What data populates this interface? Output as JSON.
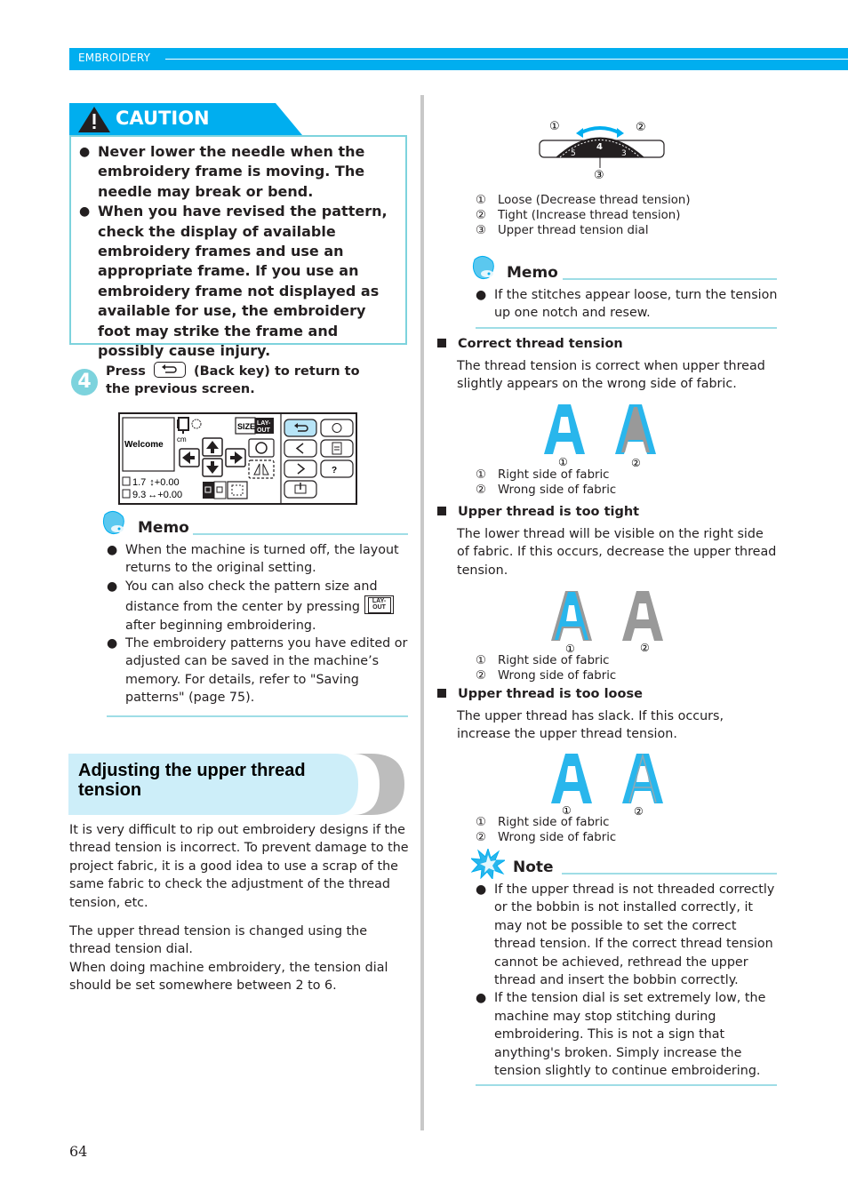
{
  "header": {
    "section_label": "EMBROIDERY"
  },
  "caution": {
    "title": "CAUTION",
    "items": [
      "Never lower the needle when the embroidery frame is moving. The needle may break or bend.",
      "When you have revised the pattern, check the display of available embroidery frames and use an appropriate frame. If you use an embroidery frame not displayed as available for use, the embroidery foot may strike the frame and possibly cause injury."
    ]
  },
  "step4": {
    "number": "4",
    "text_before": "Press",
    "key_icon": "back-key-icon",
    "text_after": "(Back key) to return to the previous screen."
  },
  "lcd": {
    "preview_text": "Welcome",
    "unit": "cm",
    "size_label": "SIZE",
    "layout_label_top": "LAY-",
    "layout_label_bottom": "OUT",
    "height_value": "1.7",
    "width_value": "9.3",
    "vertical_offset": "+0.00",
    "horizontal_offset": "+0.00"
  },
  "memo1": {
    "title": "Memo",
    "items": [
      "When the machine is turned off, the layout returns to the original setting.",
      "You can also check the pattern size and distance from the center by pressing",
      "The embroidery patterns you have edited or adjusted can be saved in the machine’s memory. For details, refer to \"Saving patterns\" (page 75)."
    ],
    "item2_tail": "after beginning embroidering.",
    "layout_key_top": "LAY-",
    "layout_key_bottom": "OUT"
  },
  "section": {
    "title": "Adjusting the upper thread tension",
    "para1": "It is very difficult to rip out embroidery designs if the thread tension is incorrect. To prevent damage to the project fabric, it is a good idea to use a scrap of the same fabric to check the adjustment of the thread tension, etc.",
    "para2": "The upper thread tension is changed using the thread tension dial.",
    "para3": "When doing machine embroidery, the tension dial should be set somewhere between 2 to 6."
  },
  "dial_figure": {
    "callouts": [
      "①",
      "②",
      "③"
    ],
    "dial_numbers": [
      "5",
      "4",
      "3"
    ],
    "legend": [
      {
        "num": "①",
        "text": "Loose (Decrease thread tension)"
      },
      {
        "num": "②",
        "text": "Tight (Increase thread tension)"
      },
      {
        "num": "③",
        "text": "Upper thread tension dial"
      }
    ]
  },
  "memo2": {
    "title": "Memo",
    "items": [
      "If the stitches appear loose, turn the tension up one notch and resew."
    ]
  },
  "cases": [
    {
      "heading": "Correct thread tension",
      "text": "The thread tension is correct when upper thread slightly appears on the wrong side of fabric.",
      "legend": [
        {
          "num": "①",
          "text": "Right side of fabric"
        },
        {
          "num": "②",
          "text": "Wrong side of fabric"
        }
      ]
    },
    {
      "heading": "Upper thread is too tight",
      "text": "The lower thread will be visible on the right side of fabric. If this occurs, decrease the upper thread tension.",
      "legend": [
        {
          "num": "①",
          "text": "Right side of fabric"
        },
        {
          "num": "②",
          "text": "Wrong side of fabric"
        }
      ]
    },
    {
      "heading": "Upper thread is too loose",
      "text": "The upper thread has slack. If this occurs, increase the upper thread tension.",
      "legend": [
        {
          "num": "①",
          "text": "Right side of fabric"
        },
        {
          "num": "②",
          "text": "Wrong side of fabric"
        }
      ]
    }
  ],
  "figure_labels": {
    "one": "①",
    "two": "②",
    "three": "③"
  },
  "note": {
    "title": "Note",
    "items": [
      "If the upper thread is not threaded correctly or the bobbin is not installed correctly, it may not be possible to set the correct thread tension. If the correct thread tension cannot be achieved, rethread the upper thread and insert the bobbin correctly.",
      "If the tension dial is set extremely low, the machine may stop stitching during embroidering. This is not a sign that anything's broken. Simply increase the tension slightly to continue embroidering."
    ]
  },
  "colors": {
    "accent": "#00aeef",
    "rule": "#9fdde6",
    "box_border": "#7dd3dd",
    "heading_bg": "#cdeef9",
    "gray": "#999999"
  },
  "footer": {
    "page_number": "64"
  }
}
